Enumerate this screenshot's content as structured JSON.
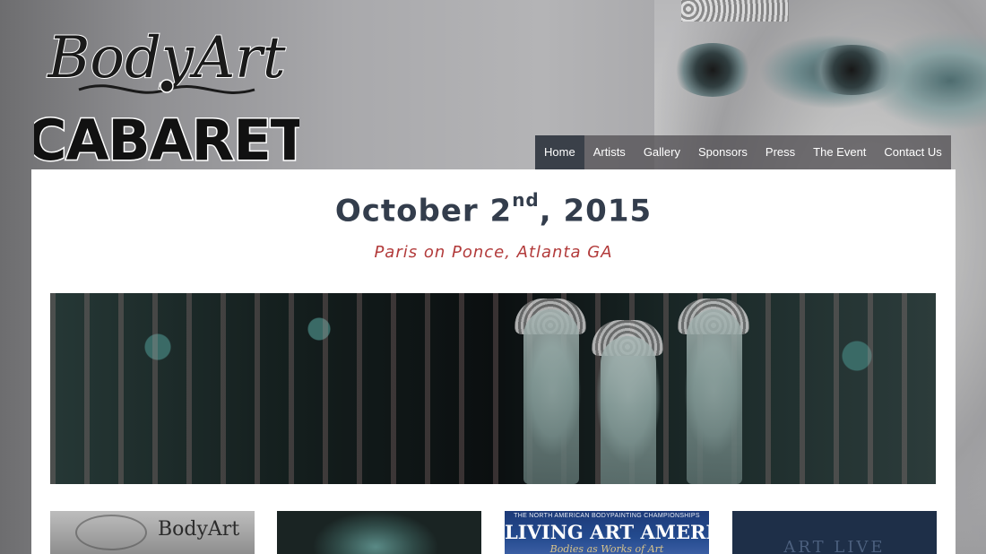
{
  "logo": {
    "line1": "BodyArt",
    "line2": "CABARET"
  },
  "nav": {
    "items": [
      {
        "label": "Home"
      },
      {
        "label": "Artists"
      },
      {
        "label": "Gallery"
      },
      {
        "label": "Sponsors"
      },
      {
        "label": "Press"
      },
      {
        "label": "The Event"
      },
      {
        "label": "Contact Us"
      }
    ],
    "active_index": 0
  },
  "event": {
    "date_main": "October 2",
    "date_suffix": "nd",
    "date_year": ", 2015",
    "location": "Paris on Ponce, Atlanta GA"
  },
  "thumbnails": {
    "t1": {
      "text": "BodyArt"
    },
    "t3": {
      "small": "THE NORTH AMERICAN BODYPAINTING CHAMPIONSHIPS",
      "big": "LIVING ART AMERICA",
      "tag": "Bodies as Works of Art"
    },
    "t4": {
      "text": "ART LIVE"
    }
  },
  "colors": {
    "title": "#333d4c",
    "subtitle": "#b23a3a",
    "nav_active_bg": "#3a4049"
  }
}
